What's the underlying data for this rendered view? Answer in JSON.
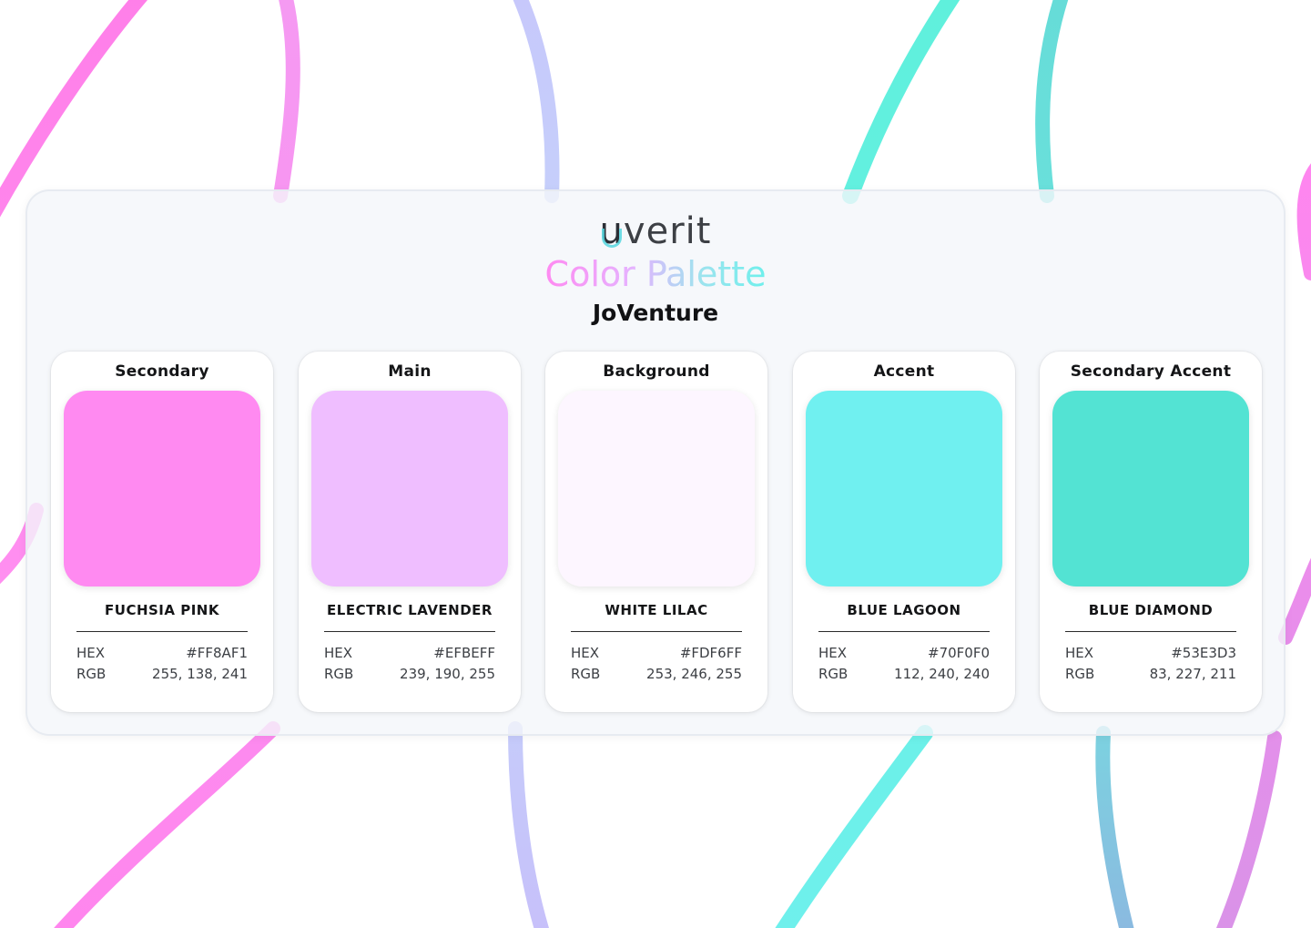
{
  "header": {
    "logo_text": "verit",
    "logo_initial": "u",
    "title": "Color Palette",
    "subtitle": "JoVenture"
  },
  "labels": {
    "hex": "HEX",
    "rgb": "RGB"
  },
  "swatches": [
    {
      "role": "Secondary",
      "name": "FUCHSIA PINK",
      "hex": "#FF8AF1",
      "rgb": "255, 138, 241",
      "color": "#FF8AF1"
    },
    {
      "role": "Main",
      "name": "ELECTRIC LAVENDER",
      "hex": "#EFBEFF",
      "rgb": "239, 190, 255",
      "color": "#EFBEFF"
    },
    {
      "role": "Background",
      "name": "WHITE LILAC",
      "hex": "#FDF6FF",
      "rgb": "253, 246, 255",
      "color": "#FDF6FF"
    },
    {
      "role": "Accent",
      "name": "BLUE LAGOON",
      "hex": "#70F0F0",
      "rgb": "112, 240, 240",
      "color": "#70F0F0"
    },
    {
      "role": "Secondary Accent",
      "name": "BLUE DIAMOND",
      "hex": "#53E3D3",
      "rgb": "83, 227, 211",
      "color": "#53E3D3"
    }
  ]
}
